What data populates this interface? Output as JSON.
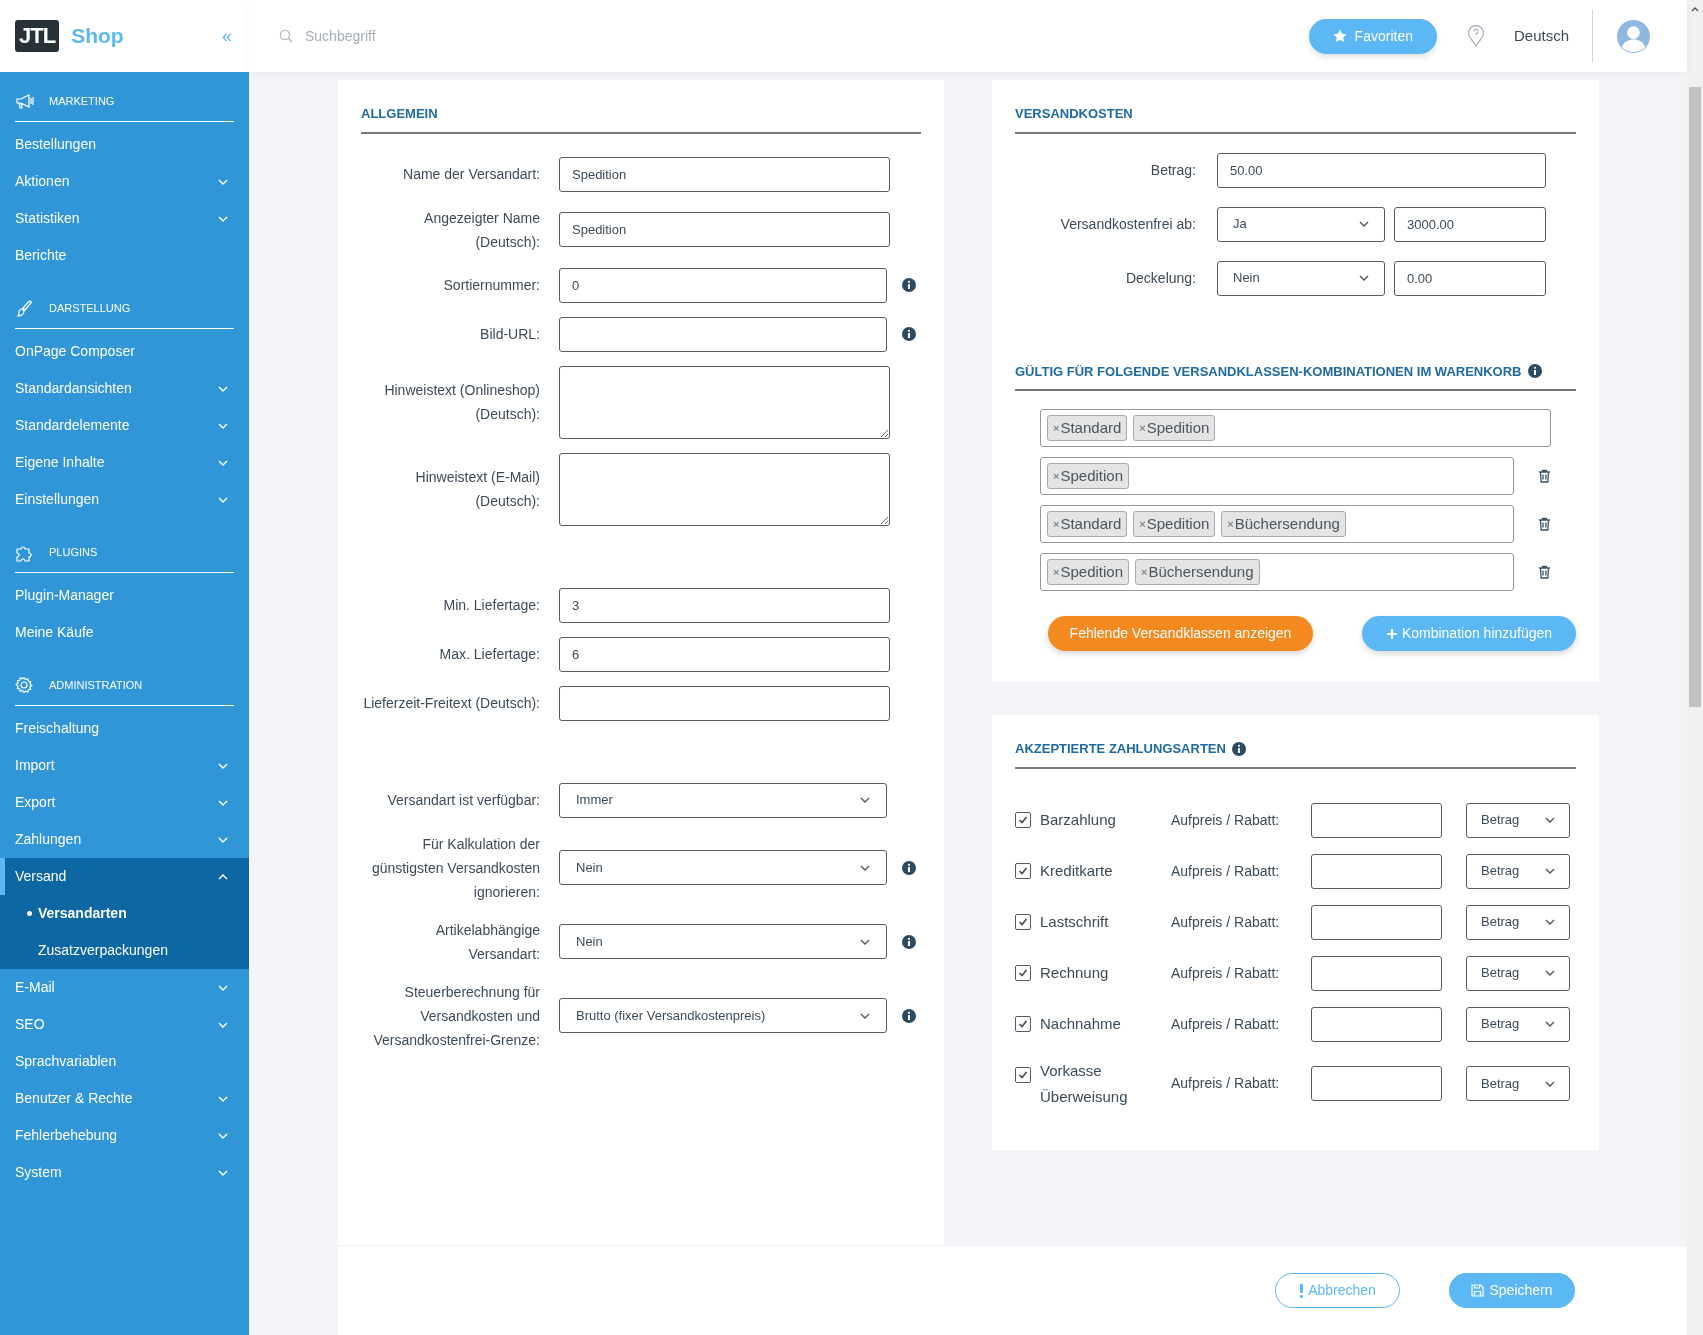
{
  "header": {
    "logo_mark": "JTL",
    "logo_text": "Shop",
    "collapse": "«",
    "search": {
      "placeholder": "Suchbegriff"
    },
    "favorites": "Favoriten",
    "language": "Deutsch"
  },
  "sidebar": {
    "sections": [
      {
        "title": "MARKETING",
        "items": [
          {
            "label": "Bestellungen",
            "has_children": false,
            "selected": false
          },
          {
            "label": "Aktionen",
            "has_children": true,
            "expanded": false,
            "selected": false
          },
          {
            "label": "Statistiken",
            "has_children": true,
            "expanded": false,
            "selected": false
          },
          {
            "label": "Berichte",
            "has_children": false,
            "selected": false
          }
        ]
      },
      {
        "title": "DARSTELLUNG",
        "items": [
          {
            "label": "OnPage Composer",
            "has_children": false,
            "selected": false
          },
          {
            "label": "Standardansichten",
            "has_children": true,
            "expanded": false,
            "selected": false
          },
          {
            "label": "Standardelemente",
            "has_children": true,
            "expanded": false,
            "selected": false
          },
          {
            "label": "Eigene Inhalte",
            "has_children": true,
            "expanded": false,
            "selected": false
          },
          {
            "label": "Einstellungen",
            "has_children": true,
            "expanded": false,
            "selected": false
          }
        ]
      },
      {
        "title": "PLUGINS",
        "items": [
          {
            "label": "Plugin-Manager",
            "has_children": false,
            "selected": false
          },
          {
            "label": "Meine Käufe",
            "has_children": false,
            "selected": false
          }
        ]
      },
      {
        "title": "ADMINISTRATION",
        "items": [
          {
            "label": "Freischaltung",
            "has_children": false,
            "selected": false
          },
          {
            "label": "Import",
            "has_children": true,
            "expanded": false,
            "selected": false
          },
          {
            "label": "Export",
            "has_children": true,
            "expanded": false,
            "selected": false
          },
          {
            "label": "Zahlungen",
            "has_children": true,
            "expanded": false,
            "selected": false
          },
          {
            "label": "Versand",
            "has_children": true,
            "expanded": true,
            "selected": true,
            "children": [
              {
                "label": "Versandarten",
                "selected": true
              },
              {
                "label": "Zusatzverpackungen",
                "selected": false
              }
            ]
          },
          {
            "label": "E-Mail",
            "has_children": true,
            "expanded": false,
            "selected": false
          },
          {
            "label": "SEO",
            "has_children": true,
            "expanded": false,
            "selected": false
          },
          {
            "label": "Sprachvariablen",
            "has_children": false,
            "selected": false
          },
          {
            "label": "Benutzer & Rechte",
            "has_children": true,
            "expanded": false,
            "selected": false
          },
          {
            "label": "Fehlerbehebung",
            "has_children": true,
            "expanded": false,
            "selected": false
          },
          {
            "label": "System",
            "has_children": true,
            "expanded": false,
            "selected": false
          }
        ]
      }
    ]
  },
  "general": {
    "title": "ALLGEMEIN",
    "groups": [
      [
        {
          "label": "Name der Versandart:",
          "kind": "text",
          "value": "Spedition",
          "info": false
        },
        {
          "label": "Angezeigter Name (Deutsch):",
          "kind": "text",
          "value": "Spedition",
          "info": false
        },
        {
          "label": "Sortiernummer:",
          "kind": "text",
          "value": "0",
          "info": true
        },
        {
          "label": "Bild-URL:",
          "kind": "text",
          "info": true
        },
        {
          "label": "Hinweistext (Onlineshop) (Deutsch):",
          "kind": "textarea",
          "info": false
        },
        {
          "label": "Hinweistext (E-Mail) (Deutsch):",
          "kind": "textarea",
          "info": false
        }
      ],
      [
        {
          "label": "Min. Liefertage:",
          "kind": "text",
          "value": "3",
          "info": false
        },
        {
          "label": "Max. Liefertage:",
          "kind": "text",
          "value": "6",
          "info": false
        },
        {
          "label": "Lieferzeit-Freitext (Deutsch):",
          "kind": "text",
          "info": false
        }
      ],
      [
        {
          "label": "Versandart ist verfügbar:",
          "kind": "select",
          "value": "Immer",
          "info": false
        },
        {
          "label": "Für Kalkulation der günstigsten Versandkosten ignorieren:",
          "kind": "select",
          "value": "Nein",
          "info": true
        },
        {
          "label": "Artikelabhängige Versandart:",
          "kind": "select",
          "value": "Nein",
          "info": true
        },
        {
          "label": "Steuerberechnung für Versandkosten und Versandkostenfrei-Grenze:",
          "kind": "select",
          "value": "Brutto (fixer Versandkostenpreis)",
          "info": true
        }
      ]
    ]
  },
  "shipping_costs": {
    "title": "VERSANDKOSTEN",
    "rows": [
      {
        "label": "Betrag:",
        "controls": [
          {
            "kind": "input",
            "value": "50.00"
          }
        ]
      },
      {
        "label": "Versandkostenfrei ab:",
        "controls": [
          {
            "kind": "select",
            "value": "Ja"
          },
          {
            "kind": "input",
            "value": "3000.00"
          }
        ]
      },
      {
        "label": "Deckelung:",
        "controls": [
          {
            "kind": "select",
            "value": "Nein"
          },
          {
            "kind": "input",
            "value": "0.00"
          }
        ]
      }
    ]
  },
  "combinations": {
    "title": "GÜLTIG FÜR FOLGENDE VERSANDKLASSEN-KOMBINATIONEN IM WARENKORB",
    "info": true,
    "rows": [
      {
        "tags": [
          "Standard",
          "Spedition"
        ],
        "deletable": false
      },
      {
        "tags": [
          "Spedition"
        ],
        "deletable": true
      },
      {
        "tags": [
          "Standard",
          "Spedition",
          "Büchersendung"
        ],
        "deletable": true
      },
      {
        "tags": [
          "Spedition",
          "Büchersendung"
        ],
        "deletable": true
      }
    ],
    "tag_remove": "×",
    "show_missing": "Fehlende Versandklassen anzeigen",
    "add": "Kombination hinzufügen"
  },
  "payments": {
    "title": "AKZEPTIERTE ZAHLUNGSARTEN",
    "info": true,
    "rows": [
      {
        "name": "Barzahlung",
        "checked": true,
        "label": "Aufpreis / Rabatt:",
        "type": "Betrag"
      },
      {
        "name": "Kreditkarte",
        "checked": true,
        "label": "Aufpreis / Rabatt:",
        "type": "Betrag"
      },
      {
        "name": "Lastschrift",
        "checked": true,
        "label": "Aufpreis / Rabatt:",
        "type": "Betrag"
      },
      {
        "name": "Rechnung",
        "checked": true,
        "label": "Aufpreis / Rabatt:",
        "type": "Betrag"
      },
      {
        "name": "Nachnahme",
        "checked": true,
        "label": "Aufpreis / Rabatt:",
        "type": "Betrag"
      },
      {
        "name": "Vorkasse Überweisung",
        "checked": true,
        "label": "Aufpreis / Rabatt:",
        "type": "Betrag"
      }
    ]
  },
  "footer": {
    "cancel": "Abbrechen",
    "save": "Speichern"
  }
}
